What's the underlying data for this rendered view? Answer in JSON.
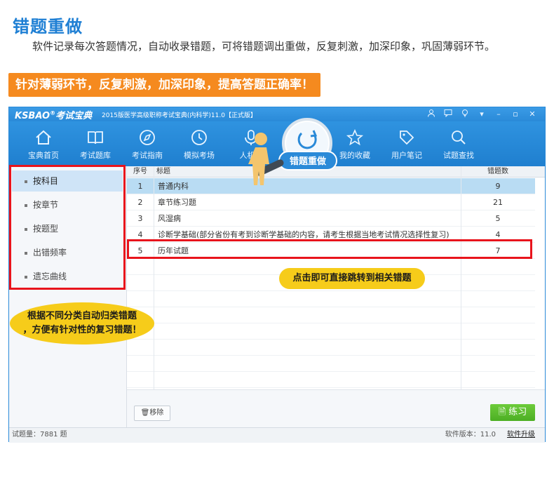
{
  "header": {
    "title": "错题重做",
    "subtitle": "软件记录每次答题情况，自动收录错题，可将错题调出重做，反复刺激，加深印象，巩固薄弱环节。",
    "banner": "针对薄弱环节，反复刺激，加深印象，提高答题正确率！"
  },
  "app": {
    "logo": "KSBAO",
    "logo_mark": "®",
    "logo_cn": "考试宝典",
    "window_title": "2015版医学高级职称考试宝典(内科学)11.0【正式版】",
    "window_controls": [
      "user-icon",
      "message-icon",
      "bulb-icon",
      "dropdown-icon",
      "minimize-icon",
      "restore-icon",
      "close-icon"
    ],
    "nav": [
      {
        "label": "宝典首页",
        "icon": "home-icon"
      },
      {
        "label": "考试题库",
        "icon": "book-icon"
      },
      {
        "label": "考试指南",
        "icon": "compass-icon"
      },
      {
        "label": "模拟考场",
        "icon": "clock-icon"
      },
      {
        "label": "人机对",
        "icon": "microphone-icon"
      },
      {
        "label": "错题重做",
        "icon": "redo-icon"
      },
      {
        "label": "我的收藏",
        "icon": "star-icon"
      },
      {
        "label": "用户笔记",
        "icon": "tag-icon"
      },
      {
        "label": "试题查找",
        "icon": "search-icon"
      }
    ],
    "sidebar": [
      {
        "label": "按科目"
      },
      {
        "label": "按章节"
      },
      {
        "label": "按题型"
      },
      {
        "label": "出错频率"
      },
      {
        "label": "遗忘曲线"
      }
    ],
    "table": {
      "headers": {
        "no": "序号",
        "title": "标题",
        "count": "错题数"
      },
      "rows": [
        {
          "no": "1",
          "title": "普通内科",
          "count": "9"
        },
        {
          "no": "2",
          "title": "章节练习题",
          "count": "21"
        },
        {
          "no": "3",
          "title": "风湿病",
          "count": "5"
        },
        {
          "no": "4",
          "title": "诊断学基础(部分省份有考到诊断学基础的内容，请考生根据当地考试情况选择性复习)",
          "count": "4"
        },
        {
          "no": "5",
          "title": "历年试题",
          "count": "7"
        }
      ]
    },
    "buttons": {
      "remove": "移除",
      "practice": "练习"
    },
    "status": {
      "count": "试题量：7881 题",
      "version": "软件版本：11.0",
      "upgrade": "软件升级"
    }
  },
  "callouts": {
    "left_line1": "根据不同分类自动归类错题",
    "left_line2": "，方便有针对性的复习错题！",
    "right": "点击即可直接跳转到相关错题"
  },
  "colors": {
    "accent_blue": "#1e7fd4",
    "banner_orange": "#f58a1f",
    "highlight_red": "#e8141c",
    "callout_yellow": "#f6cc1a",
    "practice_green": "#4caf24"
  }
}
